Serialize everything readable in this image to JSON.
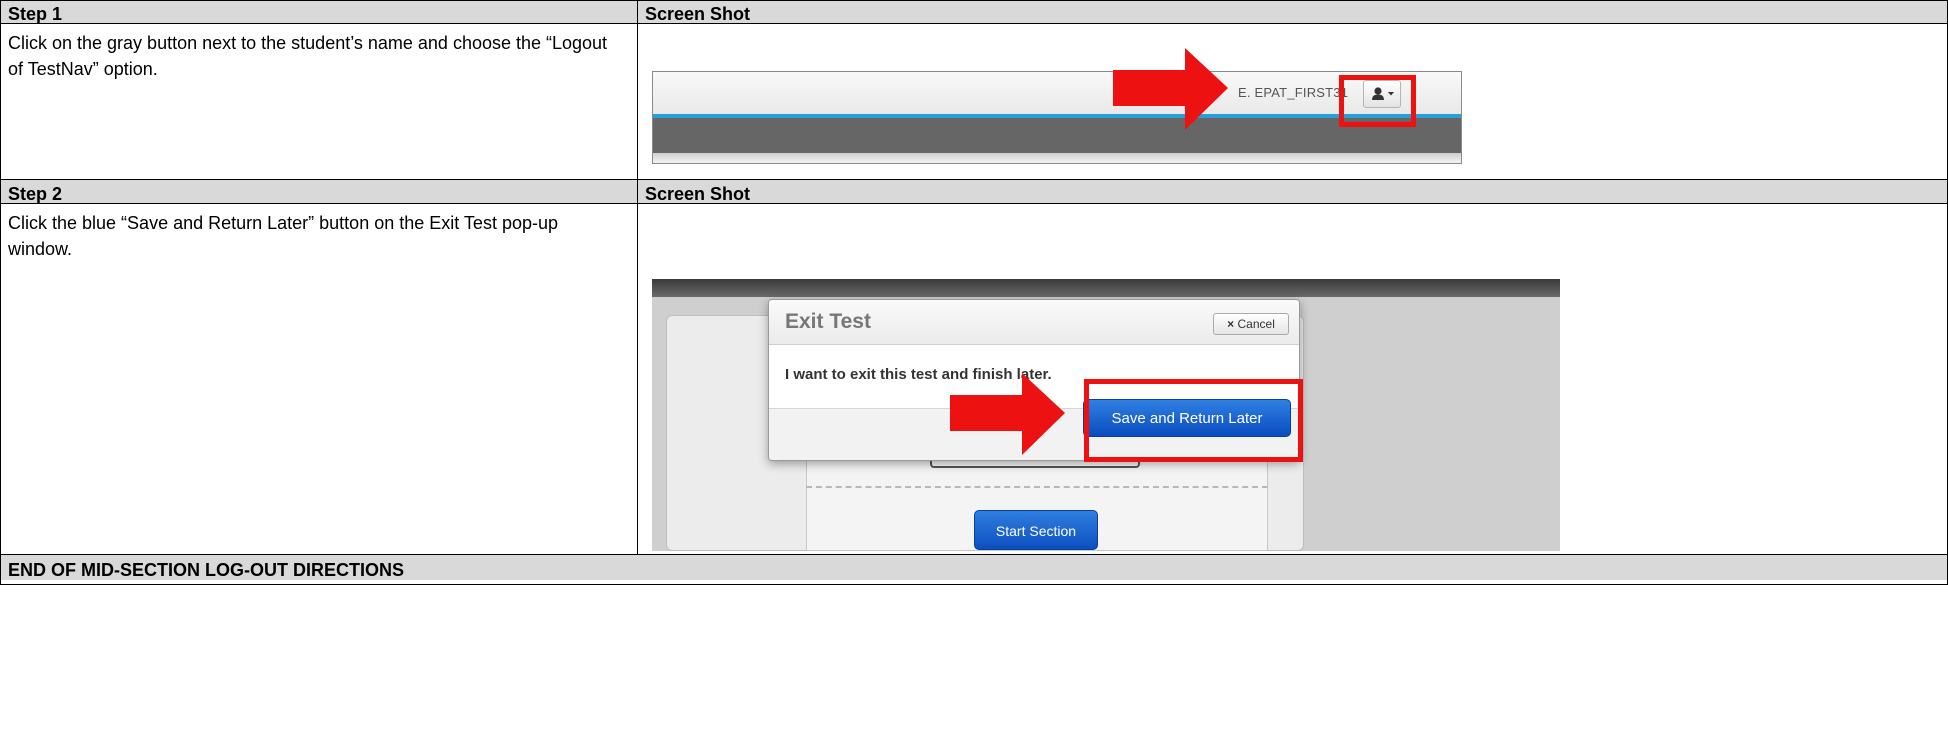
{
  "step1": {
    "heading": "Step 1",
    "shot_heading": "Screen Shot",
    "instruction": "Click on the gray button next to the student’s name and choose the “Logout of TestNav” option.",
    "screenshot": {
      "student_name": "E. EPAT_FIRST31",
      "user_button_icon": "user-icon",
      "caret_icon": "caret-down-icon"
    }
  },
  "step2": {
    "heading": "Step 2",
    "shot_heading": "Screen Shot",
    "instruction": "Click the blue “Save and Return Later” button on the Exit Test pop-up window.",
    "screenshot": {
      "dialog_title": "Exit Test",
      "cancel_label": "Cancel",
      "cancel_icon": "close-icon",
      "message": "I want to exit this test and finish later.",
      "save_label": "Save and Return Later",
      "start_label": "Start Section"
    }
  },
  "footer": {
    "text": "END OF MID-SECTION LOG-OUT DIRECTIONS"
  },
  "colors": {
    "header_bg": "#d9d9d9",
    "highlight_red": "#ee1111",
    "accent_blue": "#2a9fd6",
    "button_blue": "#0a4cc0"
  }
}
